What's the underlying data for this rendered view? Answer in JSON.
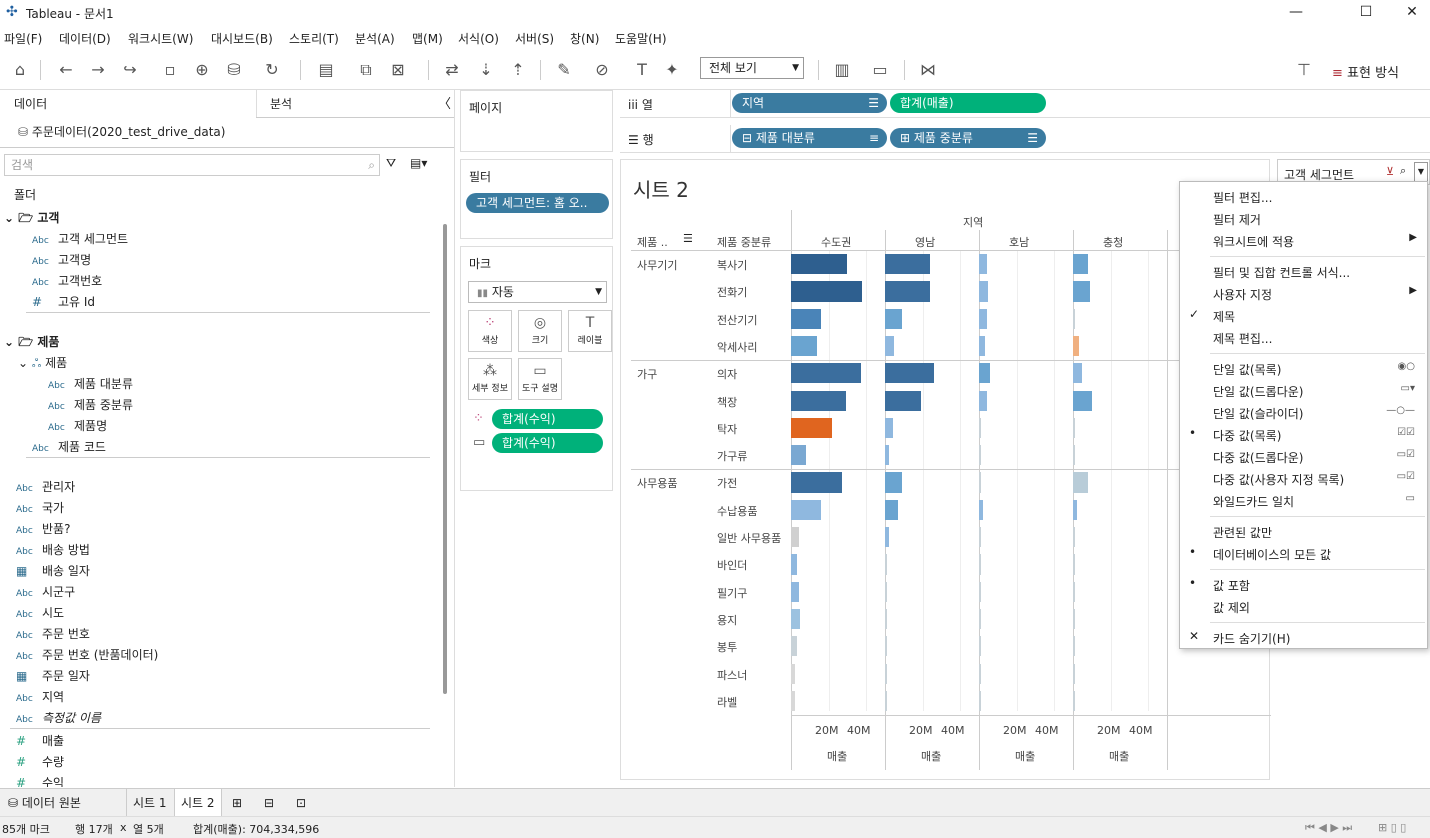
{
  "window": {
    "title": "Tableau - 문서1",
    "min": "—",
    "max": "☐",
    "close": "✕"
  },
  "menu": [
    "파일(F)",
    "데이터(D)",
    "워크시트(W)",
    "대시보드(B)",
    "스토리(T)",
    "분석(A)",
    "맵(M)",
    "서식(O)",
    "서버(S)",
    "창(N)",
    "도움말(H)"
  ],
  "toolbar": {
    "view_select": "전체 보기",
    "show_me": "표현 방식"
  },
  "left_panel": {
    "tab_data": "데이터",
    "tab_analysis": "분석",
    "collapse": "〈",
    "datasource": "주문데이터(2020_test_drive_data)",
    "search_placeholder": "검색",
    "folder_label": "폴더",
    "groups": [
      {
        "name": "고객",
        "fields": [
          {
            "t": "Abc",
            "n": "고객 세그먼트"
          },
          {
            "t": "Abc",
            "n": "고객명"
          },
          {
            "t": "Abc",
            "n": "고객번호"
          },
          {
            "t": "#",
            "n": "고유 Id"
          }
        ]
      },
      {
        "name": "제품",
        "hier": "제품",
        "fields": [
          {
            "t": "Abc",
            "n": "제품 대분류"
          },
          {
            "t": "Abc",
            "n": "제품 중분류"
          },
          {
            "t": "Abc",
            "n": "제품명"
          }
        ],
        "extra": {
          "t": "Abc",
          "n": "제품 코드"
        }
      }
    ],
    "dims": [
      {
        "t": "Abc",
        "n": "관리자"
      },
      {
        "t": "Abc",
        "n": "국가"
      },
      {
        "t": "Abc",
        "n": "반품?"
      },
      {
        "t": "Abc",
        "n": "배송 방법"
      },
      {
        "t": "cal",
        "n": "배송 일자"
      },
      {
        "t": "Abc",
        "n": "시군구"
      },
      {
        "t": "Abc",
        "n": "시도"
      },
      {
        "t": "Abc",
        "n": "주문 번호"
      },
      {
        "t": "Abc",
        "n": "주문 번호 (반품데이터)"
      },
      {
        "t": "cal",
        "n": "주문 일자"
      },
      {
        "t": "Abc",
        "n": "지역"
      },
      {
        "t": "Abc",
        "n": "측정값 이름"
      }
    ],
    "measures": [
      {
        "t": "#",
        "n": "매출"
      },
      {
        "t": "#",
        "n": "수량"
      },
      {
        "t": "#",
        "n": "수익"
      }
    ]
  },
  "pages_title": "페이지",
  "filters_title": "필터",
  "filter_pill": "고객 세그먼트: 홈 오..",
  "marks": {
    "title": "마크",
    "type": "자동",
    "color": "색상",
    "size": "크기",
    "label": "레이블",
    "detail": "세부 정보",
    "tooltip": "도구 설명",
    "pill1": "합계(수익)",
    "pill2": "합계(수익)"
  },
  "shelves": {
    "columns_label": "열",
    "rows_label": "행",
    "col_pills": [
      "지역",
      "합계(매출)"
    ],
    "row_pills": [
      "제품 대분류",
      "제품 중분류"
    ]
  },
  "view": {
    "sheet_title": "시트 2",
    "col_header": "지역",
    "row_hdr1": "제품 ..",
    "row_hdr2": "제품 중분류",
    "axis_ticks": [
      "20M",
      "40M"
    ],
    "axis_title": "매출"
  },
  "chart_data": {
    "type": "bar",
    "title": "시트 2",
    "xlabel": "매출",
    "columns_dimension": "지역",
    "regions": [
      "수도권",
      "영남",
      "호남",
      "충청"
    ],
    "categories": [
      {
        "group": "사무기기",
        "items": [
          "복사기",
          "전화기",
          "전산기기",
          "악세사리"
        ]
      },
      {
        "group": "가구",
        "items": [
          "의자",
          "책장",
          "탁자",
          "가구류"
        ]
      },
      {
        "group": "사무용품",
        "items": [
          "가전",
          "수납용품",
          "일반 사무용품",
          "바인더",
          "필기구",
          "용지",
          "봉투",
          "파스너",
          "라벨"
        ]
      }
    ],
    "xlim": [
      0,
      50
    ],
    "series": [
      {
        "name": "수도권",
        "values": [
          30,
          38,
          16,
          14,
          37,
          29,
          22,
          8,
          27,
          16,
          4,
          3,
          4,
          5,
          3,
          2,
          2
        ]
      },
      {
        "name": "영남",
        "values": [
          24,
          24,
          9,
          5,
          26,
          19,
          4,
          2,
          9,
          7,
          2,
          1,
          1,
          1,
          1,
          0.5,
          0.5
        ]
      },
      {
        "name": "호남",
        "values": [
          4,
          5,
          4,
          3,
          6,
          4,
          0.5,
          0.5,
          1,
          2,
          0.5,
          0.5,
          0.5,
          0.5,
          0.5,
          0.3,
          0.3
        ]
      },
      {
        "name": "충청",
        "values": [
          8,
          9,
          1,
          3,
          5,
          10,
          0.5,
          1,
          8,
          2,
          0.5,
          0.5,
          0.5,
          0.5,
          0.5,
          0.3,
          0.3
        ]
      }
    ],
    "colors": [
      "#2e5f8f",
      "#2e5f8f",
      "#4a84b8",
      "#6aa4d0",
      "#3b6e9e",
      "#3b6e9e",
      "#e0651f",
      "#7aa8d2",
      "#3b6e9e",
      "#8fb8df",
      "#d0d0d0",
      "#8fb8df",
      "#8fb8df",
      "#9cc2e0",
      "#c8d2d8",
      "#d8d8d8",
      "#d8d8d8"
    ]
  },
  "filter_card": {
    "title": "고객 세그먼트"
  },
  "context_menu": [
    {
      "label": "필터 편집...",
      "mark": "",
      "arrow": false
    },
    {
      "label": "필터 제거",
      "mark": "",
      "arrow": false
    },
    {
      "label": "워크시트에 적용",
      "mark": "",
      "arrow": true
    },
    {
      "sep": true
    },
    {
      "label": "필터 및 집합 컨트롤 서식...",
      "mark": "",
      "arrow": false
    },
    {
      "label": "사용자 지정",
      "mark": "",
      "arrow": true
    },
    {
      "label": "제목",
      "mark": "✓",
      "arrow": false
    },
    {
      "label": "제목 편집...",
      "mark": "",
      "arrow": false
    },
    {
      "sep": true
    },
    {
      "label": "단일 값(목록)",
      "mark": "",
      "right": "◉○"
    },
    {
      "label": "단일 값(드롭다운)",
      "mark": "",
      "right": "▭▾"
    },
    {
      "label": "단일 값(슬라이더)",
      "mark": "",
      "right": "—○—"
    },
    {
      "label": "다중 값(목록)",
      "mark": "•",
      "right": "☑☑"
    },
    {
      "label": "다중 값(드롭다운)",
      "mark": "",
      "right": "▭☑"
    },
    {
      "label": "다중 값(사용자 지정 목록)",
      "mark": "",
      "right": "▭☑"
    },
    {
      "label": "와일드카드 일치",
      "mark": "",
      "right": "▭"
    },
    {
      "sep": true
    },
    {
      "label": "관련된 값만",
      "mark": ""
    },
    {
      "label": "데이터베이스의 모든 값",
      "mark": "•"
    },
    {
      "sep": true
    },
    {
      "label": "값 포함",
      "mark": "•"
    },
    {
      "label": "값 제외",
      "mark": ""
    },
    {
      "sep": true
    },
    {
      "label": "카드 숨기기(H)",
      "mark": "✕"
    }
  ],
  "sheet_tabs": {
    "datasource": "데이터 원본",
    "sheet1": "시트 1",
    "sheet2": "시트 2"
  },
  "status": {
    "marks": "85개 마크",
    "rows": "행 17개",
    "x": "x",
    "cols": "열 5개",
    "sum": "합계(매출): 704,334,596"
  }
}
